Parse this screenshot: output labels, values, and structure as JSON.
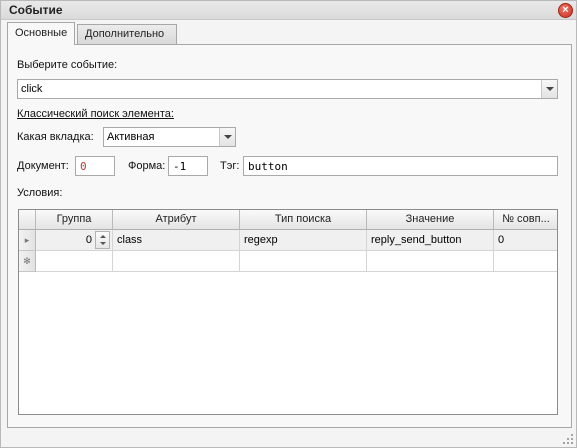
{
  "window": {
    "title": "Событие"
  },
  "tabs": [
    {
      "label": "Основные",
      "active": true
    },
    {
      "label": "Дополнительно",
      "active": false
    }
  ],
  "form": {
    "event_label": "Выберите событие:",
    "event_value": "click",
    "classic_search_label": "Классический поиск элемента:",
    "tab_label": "Какая вкладка:",
    "tab_value": "Активная",
    "document_label": "Документ:",
    "document_value": "0",
    "form_label": "Форма:",
    "form_value": "-1",
    "tag_label": "Тэг:",
    "tag_value": "button",
    "conditions_label": "Условия:"
  },
  "table": {
    "columns": [
      "Группа",
      "Атрибут",
      "Тип поиска",
      "Значение",
      "№ совп..."
    ],
    "rows": [
      {
        "group": "0",
        "attribute": "class",
        "search_type": "regexp",
        "value": "reply_send_button",
        "match_no": "0"
      }
    ],
    "new_row_marker": "✻"
  },
  "colors": {
    "accent": "#c62d1c",
    "input_highlight": "#c0392b"
  }
}
